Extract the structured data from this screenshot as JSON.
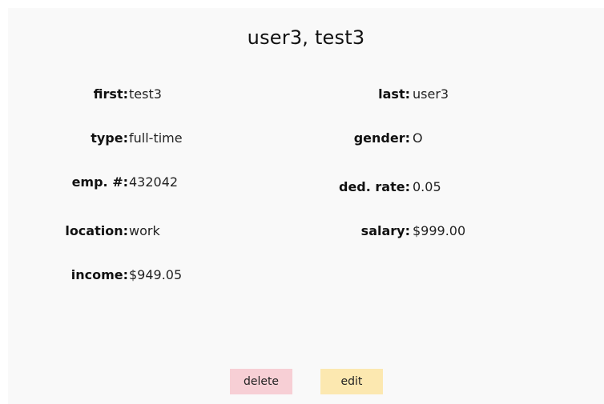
{
  "title": "user3, test3",
  "fields": {
    "first": {
      "label": "first:",
      "value": "test3"
    },
    "last": {
      "label": "last:",
      "value": "user3"
    },
    "type": {
      "label": "type:",
      "value": "full-time"
    },
    "gender": {
      "label": "gender:",
      "value": "O"
    },
    "emp_no": {
      "label": "emp. #:",
      "value": "432042"
    },
    "ded_rate": {
      "label": "ded. rate:",
      "value": "0.05"
    },
    "location": {
      "label": "location:",
      "value": "work"
    },
    "salary": {
      "label": "salary:",
      "value": "$999.00"
    },
    "income": {
      "label": "income:",
      "value": "$949.05"
    }
  },
  "actions": {
    "delete_label": "delete",
    "edit_label": "edit"
  },
  "colors": {
    "card_background": "#f9f9f9",
    "delete_button": "#f7cfd5",
    "edit_button": "#fce8b0"
  }
}
